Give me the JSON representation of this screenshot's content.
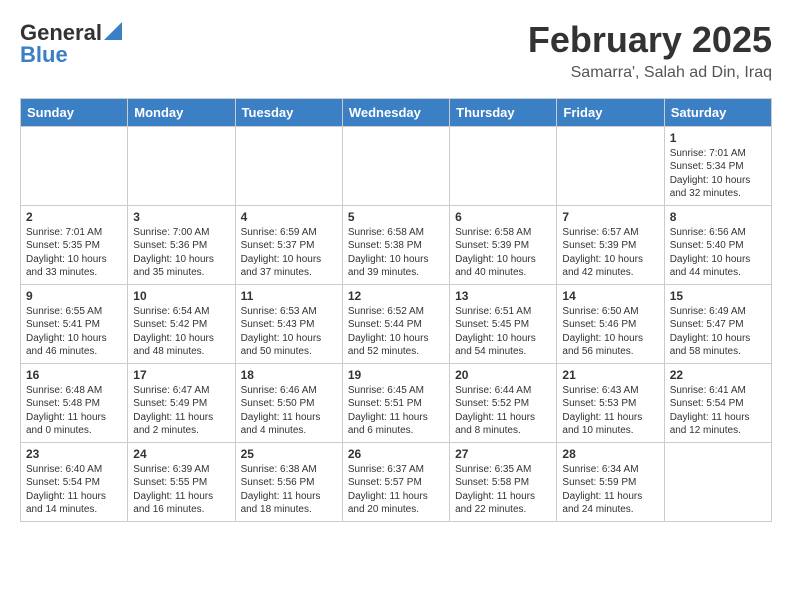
{
  "header": {
    "logo_general": "General",
    "logo_blue": "Blue",
    "month_title": "February 2025",
    "location": "Samarra', Salah ad Din, Iraq"
  },
  "weekdays": [
    "Sunday",
    "Monday",
    "Tuesday",
    "Wednesday",
    "Thursday",
    "Friday",
    "Saturday"
  ],
  "weeks": [
    [
      {
        "day": "",
        "info": ""
      },
      {
        "day": "",
        "info": ""
      },
      {
        "day": "",
        "info": ""
      },
      {
        "day": "",
        "info": ""
      },
      {
        "day": "",
        "info": ""
      },
      {
        "day": "",
        "info": ""
      },
      {
        "day": "1",
        "info": "Sunrise: 7:01 AM\nSunset: 5:34 PM\nDaylight: 10 hours and 32 minutes."
      }
    ],
    [
      {
        "day": "2",
        "info": "Sunrise: 7:01 AM\nSunset: 5:35 PM\nDaylight: 10 hours and 33 minutes."
      },
      {
        "day": "3",
        "info": "Sunrise: 7:00 AM\nSunset: 5:36 PM\nDaylight: 10 hours and 35 minutes."
      },
      {
        "day": "4",
        "info": "Sunrise: 6:59 AM\nSunset: 5:37 PM\nDaylight: 10 hours and 37 minutes."
      },
      {
        "day": "5",
        "info": "Sunrise: 6:58 AM\nSunset: 5:38 PM\nDaylight: 10 hours and 39 minutes."
      },
      {
        "day": "6",
        "info": "Sunrise: 6:58 AM\nSunset: 5:39 PM\nDaylight: 10 hours and 40 minutes."
      },
      {
        "day": "7",
        "info": "Sunrise: 6:57 AM\nSunset: 5:39 PM\nDaylight: 10 hours and 42 minutes."
      },
      {
        "day": "8",
        "info": "Sunrise: 6:56 AM\nSunset: 5:40 PM\nDaylight: 10 hours and 44 minutes."
      }
    ],
    [
      {
        "day": "9",
        "info": "Sunrise: 6:55 AM\nSunset: 5:41 PM\nDaylight: 10 hours and 46 minutes."
      },
      {
        "day": "10",
        "info": "Sunrise: 6:54 AM\nSunset: 5:42 PM\nDaylight: 10 hours and 48 minutes."
      },
      {
        "day": "11",
        "info": "Sunrise: 6:53 AM\nSunset: 5:43 PM\nDaylight: 10 hours and 50 minutes."
      },
      {
        "day": "12",
        "info": "Sunrise: 6:52 AM\nSunset: 5:44 PM\nDaylight: 10 hours and 52 minutes."
      },
      {
        "day": "13",
        "info": "Sunrise: 6:51 AM\nSunset: 5:45 PM\nDaylight: 10 hours and 54 minutes."
      },
      {
        "day": "14",
        "info": "Sunrise: 6:50 AM\nSunset: 5:46 PM\nDaylight: 10 hours and 56 minutes."
      },
      {
        "day": "15",
        "info": "Sunrise: 6:49 AM\nSunset: 5:47 PM\nDaylight: 10 hours and 58 minutes."
      }
    ],
    [
      {
        "day": "16",
        "info": "Sunrise: 6:48 AM\nSunset: 5:48 PM\nDaylight: 11 hours and 0 minutes."
      },
      {
        "day": "17",
        "info": "Sunrise: 6:47 AM\nSunset: 5:49 PM\nDaylight: 11 hours and 2 minutes."
      },
      {
        "day": "18",
        "info": "Sunrise: 6:46 AM\nSunset: 5:50 PM\nDaylight: 11 hours and 4 minutes."
      },
      {
        "day": "19",
        "info": "Sunrise: 6:45 AM\nSunset: 5:51 PM\nDaylight: 11 hours and 6 minutes."
      },
      {
        "day": "20",
        "info": "Sunrise: 6:44 AM\nSunset: 5:52 PM\nDaylight: 11 hours and 8 minutes."
      },
      {
        "day": "21",
        "info": "Sunrise: 6:43 AM\nSunset: 5:53 PM\nDaylight: 11 hours and 10 minutes."
      },
      {
        "day": "22",
        "info": "Sunrise: 6:41 AM\nSunset: 5:54 PM\nDaylight: 11 hours and 12 minutes."
      }
    ],
    [
      {
        "day": "23",
        "info": "Sunrise: 6:40 AM\nSunset: 5:54 PM\nDaylight: 11 hours and 14 minutes."
      },
      {
        "day": "24",
        "info": "Sunrise: 6:39 AM\nSunset: 5:55 PM\nDaylight: 11 hours and 16 minutes."
      },
      {
        "day": "25",
        "info": "Sunrise: 6:38 AM\nSunset: 5:56 PM\nDaylight: 11 hours and 18 minutes."
      },
      {
        "day": "26",
        "info": "Sunrise: 6:37 AM\nSunset: 5:57 PM\nDaylight: 11 hours and 20 minutes."
      },
      {
        "day": "27",
        "info": "Sunrise: 6:35 AM\nSunset: 5:58 PM\nDaylight: 11 hours and 22 minutes."
      },
      {
        "day": "28",
        "info": "Sunrise: 6:34 AM\nSunset: 5:59 PM\nDaylight: 11 hours and 24 minutes."
      },
      {
        "day": "",
        "info": ""
      }
    ]
  ]
}
